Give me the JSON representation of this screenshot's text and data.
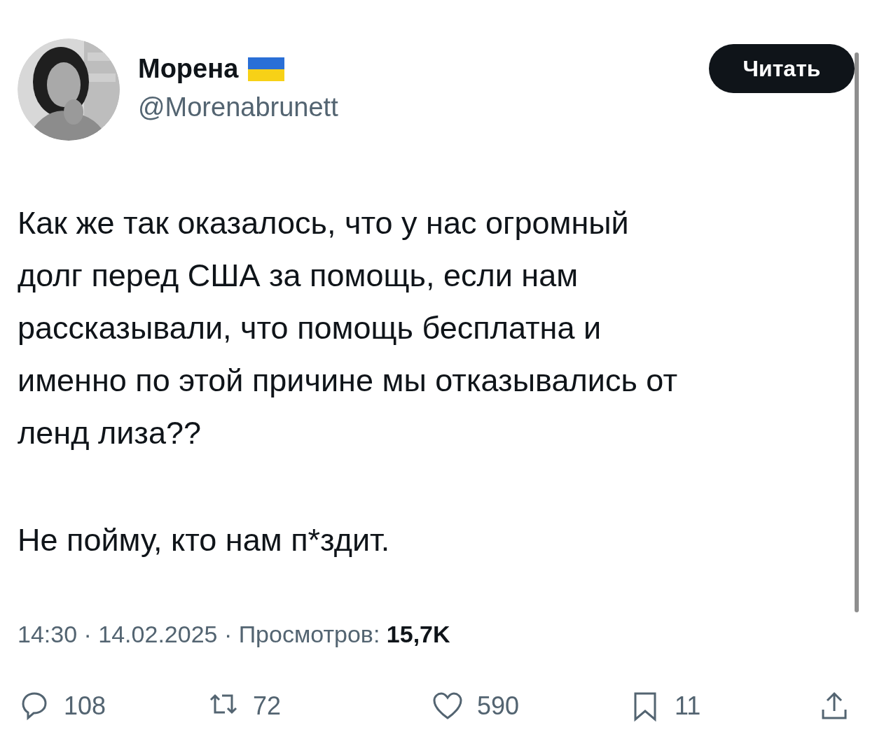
{
  "author": {
    "name": "Морена",
    "handle": "@Morenabrunett"
  },
  "follow_button": {
    "label": "Читать"
  },
  "tweet": {
    "paragraphs": [
      "Как же так оказалось, что у нас огромный\nдолг перед США за помощь, если нам\nрассказывали, что помощь бесплатна и\nименно по этой причине мы отказывались от\nленд лиза??",
      "Не пойму, кто нам п*здит."
    ],
    "meta": "14:30 · 14.02.2025 · Просмотров: **15,7K**"
  },
  "actions": [
    {
      "kind": "reply",
      "count": "108"
    },
    {
      "kind": "retweet",
      "count": "72"
    },
    {
      "kind": "like",
      "count": "590"
    },
    {
      "kind": "bookmark",
      "count": "11"
    },
    {
      "kind": "share"
    }
  ]
}
